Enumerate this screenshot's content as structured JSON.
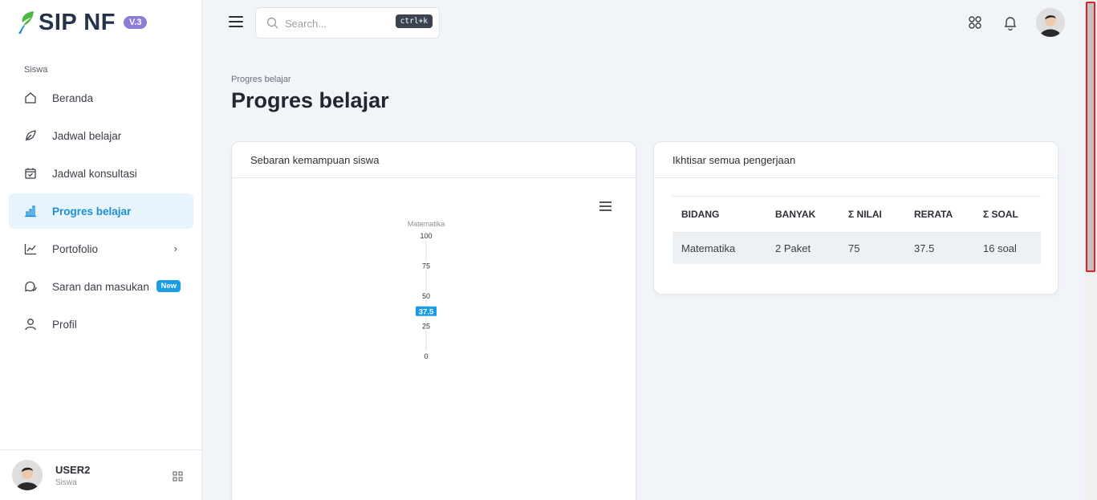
{
  "app": {
    "logo_text": "SIP NF",
    "version_badge": "V.3"
  },
  "sidebar": {
    "section_label": "Siswa",
    "items": [
      {
        "label": "Beranda",
        "icon": "home-icon"
      },
      {
        "label": "Jadwal belajar",
        "icon": "leaf-icon"
      },
      {
        "label": "Jadwal konsultasi",
        "icon": "calendar-check-icon"
      },
      {
        "label": "Progres belajar",
        "icon": "bar-chart-icon",
        "active": true
      },
      {
        "label": "Portofolio",
        "icon": "line-chart-icon",
        "chevron": "›"
      },
      {
        "label": "Saran dan masukan",
        "icon": "chat-icon",
        "badge": "New"
      },
      {
        "label": "Profil",
        "icon": "user-icon"
      }
    ],
    "user": {
      "name": "USER2",
      "role": "Siswa"
    }
  },
  "topbar": {
    "search_placeholder": "Search...",
    "shortcut": "ctrl+k"
  },
  "page": {
    "breadcrumb": "Progres belajar",
    "title": "Progres belajar"
  },
  "cards": {
    "left_title": "Sebaran kemampuan siswa",
    "right_title": "Ikhtisar semua pengerjaan"
  },
  "table": {
    "headers": [
      "BIDANG",
      "BANYAK",
      "Σ NILAI",
      "RERATA",
      "Σ SOAL"
    ],
    "rows": [
      [
        "Matematika",
        "2 Paket",
        "75",
        "37.5",
        "16 soal"
      ]
    ]
  },
  "chart_data": {
    "type": "scatter",
    "categories": [
      "Matematika"
    ],
    "values": [
      37.5
    ],
    "data_labels": [
      "37.5"
    ],
    "ylim": [
      0,
      100
    ],
    "yticks": [
      "100",
      "75",
      "50",
      "25",
      "0"
    ],
    "grid": false,
    "point_color": "#1a9de6"
  },
  "colors": {
    "accent": "#1a9de6",
    "active_bg": "#e8f4fb",
    "badge_purple": "#8e7cd6"
  }
}
